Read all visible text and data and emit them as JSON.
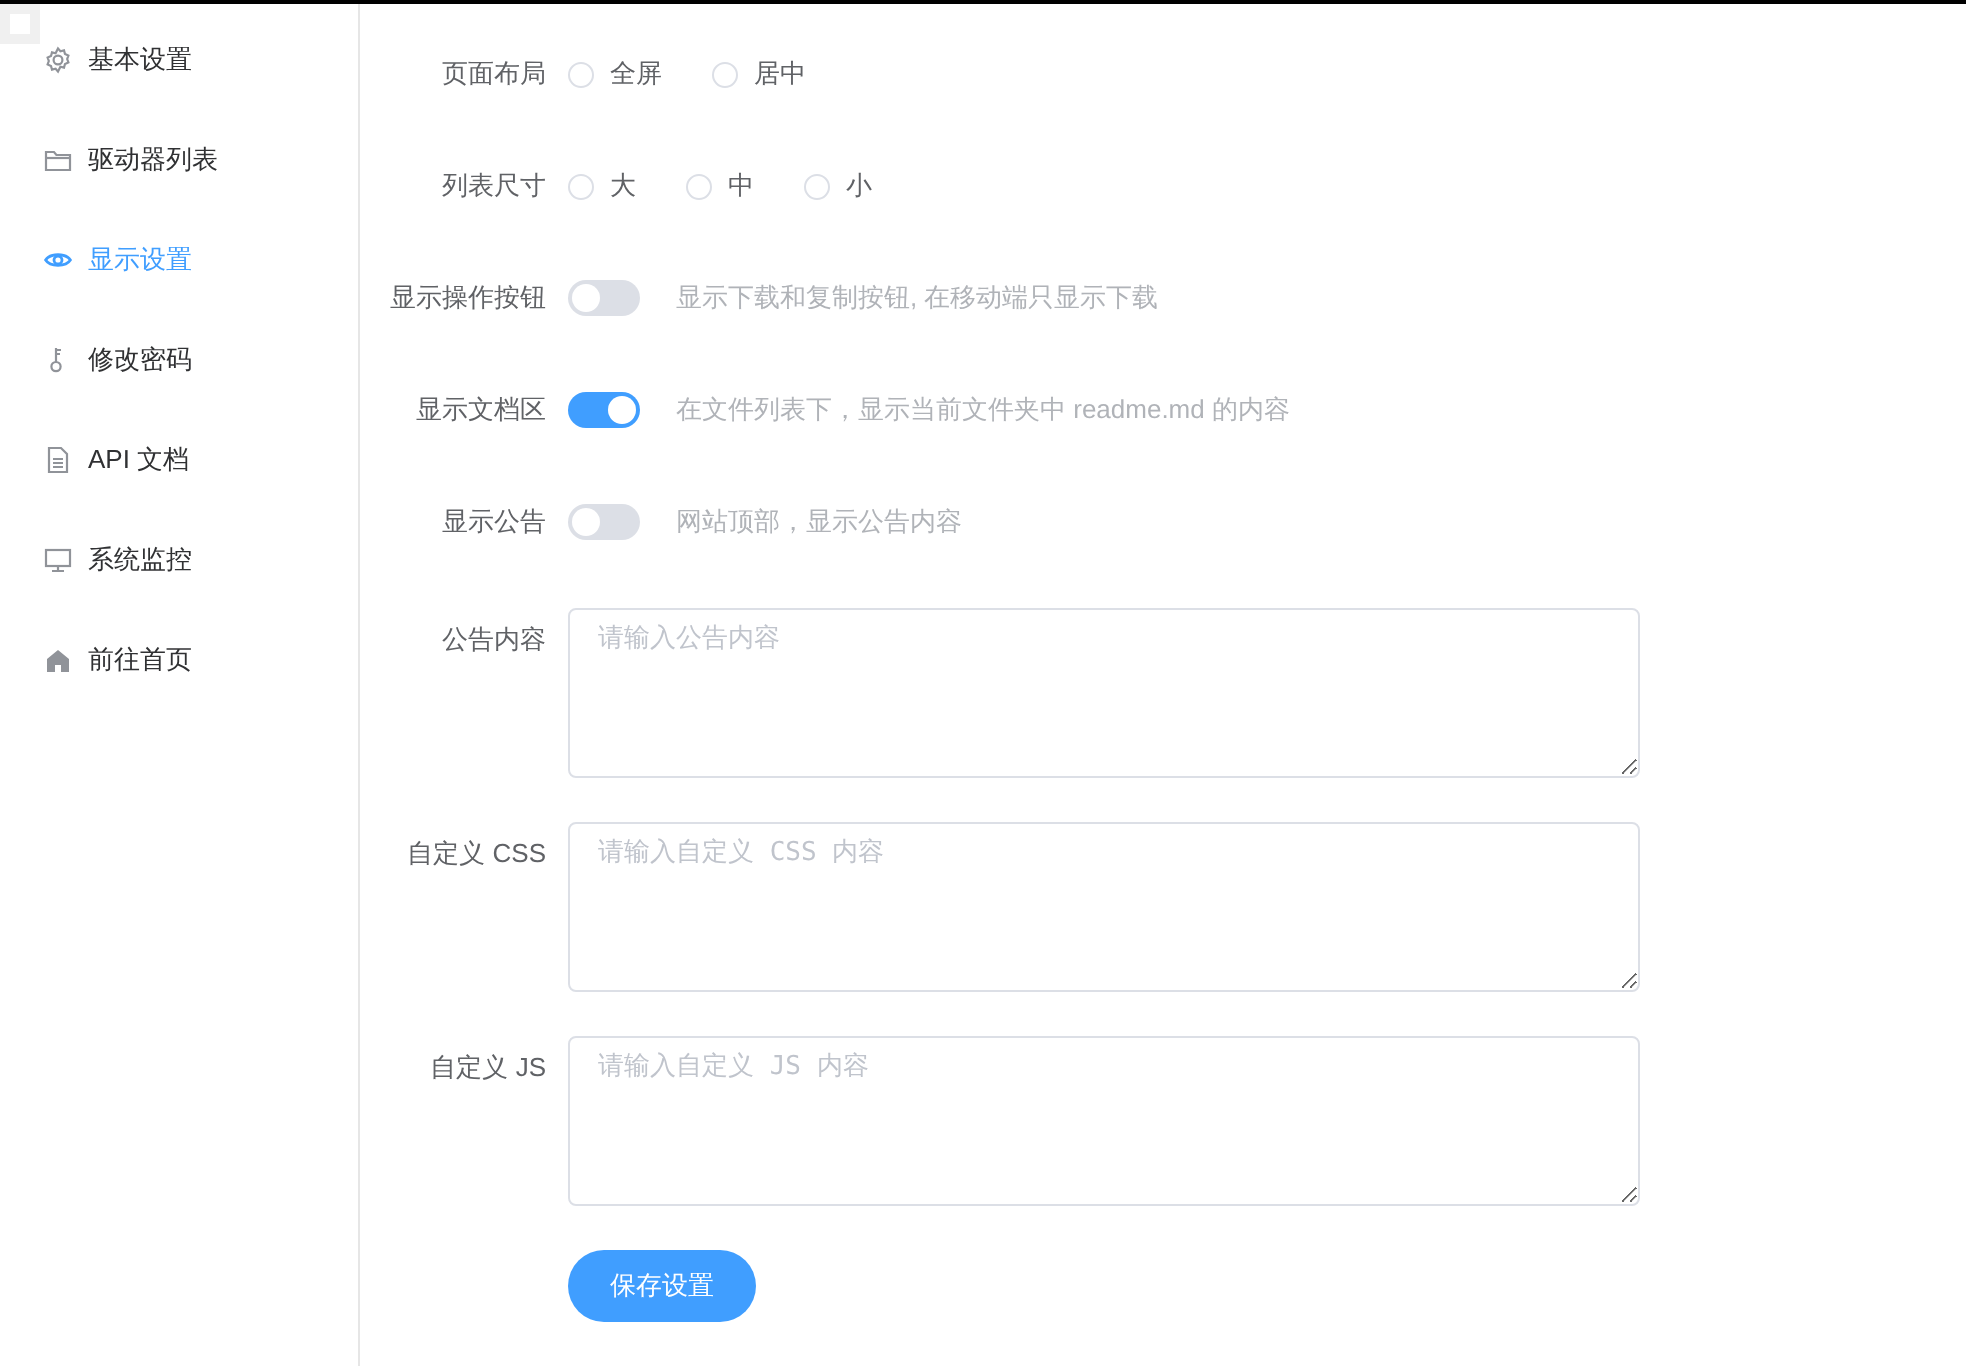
{
  "sidebar": {
    "items": [
      {
        "label": "基本设置",
        "selected": false
      },
      {
        "label": "驱动器列表",
        "selected": false
      },
      {
        "label": "显示设置",
        "selected": true
      },
      {
        "label": "修改密码",
        "selected": false
      },
      {
        "label": "API 文档",
        "selected": false
      },
      {
        "label": "系统监控",
        "selected": false
      },
      {
        "label": "前往首页",
        "selected": false
      }
    ]
  },
  "form": {
    "rows": [
      {
        "kind": "radio",
        "label": "页面布局",
        "options": [
          {
            "label": "全屏",
            "selected": false
          },
          {
            "label": "居中",
            "selected": false
          }
        ]
      },
      {
        "kind": "radio",
        "label": "列表尺寸",
        "options": [
          {
            "label": "大",
            "selected": false
          },
          {
            "label": "中",
            "selected": false
          },
          {
            "label": "小",
            "selected": false
          }
        ]
      },
      {
        "kind": "switch",
        "label": "显示操作按钮",
        "on": false,
        "hint": "显示下载和复制按钮, 在移动端只显示下载"
      },
      {
        "kind": "switch",
        "label": "显示文档区",
        "on": true,
        "hint": "在文件列表下，显示当前文件夹中 readme.md 的内容"
      },
      {
        "kind": "switch",
        "label": "显示公告",
        "on": false,
        "hint": "网站顶部，显示公告内容"
      },
      {
        "kind": "textarea",
        "label": "公告内容",
        "placeholder": "请输入公告内容"
      },
      {
        "kind": "textarea",
        "label": "自定义 CSS",
        "placeholder": "请输入自定义 CSS 内容"
      },
      {
        "kind": "textarea",
        "label": "自定义 JS",
        "placeholder": "请输入自定义 JS 内容"
      }
    ],
    "save_button": "保存设置"
  }
}
